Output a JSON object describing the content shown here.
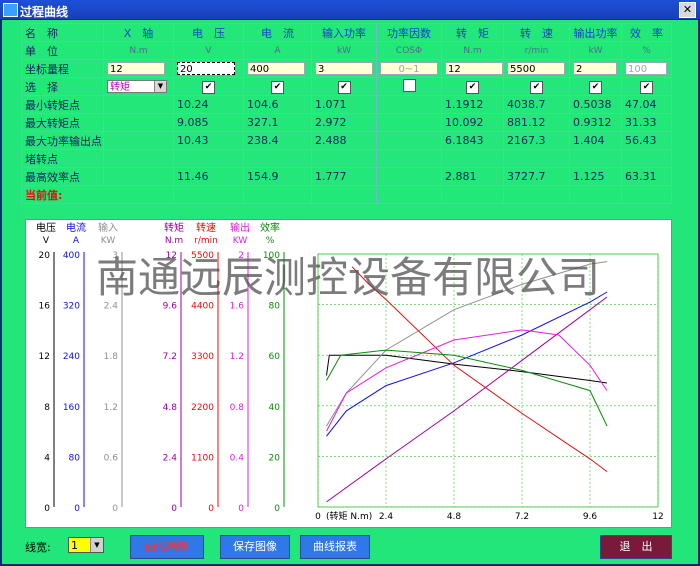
{
  "window": {
    "title": "过程曲线",
    "close_glyph": "✕"
  },
  "table": {
    "headers": [
      "名　称",
      "X　轴",
      "电　压",
      "电　流",
      "输入功率",
      "功率因数",
      "转　矩",
      "转　速",
      "输出功率",
      "效　率"
    ],
    "units_label": "单　位",
    "units": [
      "N.m",
      "V",
      "A",
      "kW",
      "COSΦ",
      "N.m",
      "r/min",
      "kW",
      "%"
    ],
    "range_label": "坐标量程",
    "ranges": [
      "12",
      "20",
      "400",
      "3",
      "0~1",
      "12",
      "5500",
      "2",
      "100"
    ],
    "select_label": "选　择",
    "select_value": "转矩",
    "rows": [
      {
        "label": "最小转矩点",
        "values": [
          "10.24",
          "104.6",
          "1.071",
          "",
          "1.1912",
          "4038.7",
          "0.5038",
          "47.04"
        ]
      },
      {
        "label": "最大转矩点",
        "values": [
          "9.085",
          "327.1",
          "2.972",
          "",
          "10.092",
          "881.12",
          "0.9312",
          "31.33"
        ]
      },
      {
        "label": "最大功率输出点",
        "values": [
          "10.43",
          "238.4",
          "2.488",
          "",
          "6.1843",
          "2167.3",
          "1.404",
          "56.43"
        ]
      },
      {
        "label": "堵转点",
        "values": [
          "",
          "",
          "",
          "",
          "",
          "",
          "",
          ""
        ]
      },
      {
        "label": "最高效率点",
        "values": [
          "11.46",
          "154.9",
          "1.777",
          "",
          "2.881",
          "3727.7",
          "1.125",
          "63.31"
        ]
      }
    ],
    "current_label": "当前值:"
  },
  "chart": {
    "watermark": "南通远辰测控设备有限公司",
    "axes": [
      {
        "name": "电压",
        "unit": "V",
        "ticks": [
          "20",
          "16",
          "12",
          "8",
          "4",
          "0"
        ],
        "color": "#000000"
      },
      {
        "name": "电流",
        "unit": "A",
        "ticks": [
          "400",
          "320",
          "240",
          "160",
          "80",
          "0"
        ],
        "color": "#1010e0"
      },
      {
        "name": "输入",
        "unit": "KW",
        "ticks": [
          "3",
          "2.4",
          "1.8",
          "1.2",
          "0.6",
          "0"
        ],
        "color": "#909090"
      },
      {
        "name": "转矩",
        "unit": "N.m",
        "ticks": [
          "12",
          "9.6",
          "7.2",
          "4.8",
          "2.4",
          "0"
        ],
        "color": "#a000a0"
      },
      {
        "name": "转速",
        "unit": "r/min",
        "ticks": [
          "5500",
          "4400",
          "3300",
          "2200",
          "1100",
          "0"
        ],
        "color": "#e01010"
      },
      {
        "name": "输出",
        "unit": "KW",
        "ticks": [
          "2",
          "1.6",
          "1.2",
          "0.8",
          "0.4",
          "0"
        ],
        "color": "#e020e0"
      },
      {
        "name": "效率",
        "unit": "%",
        "ticks": [
          "100",
          "80",
          "60",
          "40",
          "20",
          "0"
        ],
        "color": "#0a8a0a"
      }
    ],
    "x_ticks": [
      "0",
      "2.4",
      "4.8",
      "7.2",
      "9.6",
      "12"
    ],
    "x_label": "(转矩 N.m)"
  },
  "chart_data": {
    "type": "line",
    "xlabel": "(转矩 N.m)",
    "xlim": [
      0,
      12
    ],
    "ylim": [
      0,
      100
    ],
    "series": [
      {
        "name": "电压",
        "color": "#000000",
        "x": [
          0.3,
          0.4,
          2.4,
          4.8,
          7.2,
          9.6,
          10.2
        ],
        "y": [
          52,
          60,
          60,
          56.5,
          53.5,
          50,
          49
        ]
      },
      {
        "name": "电流",
        "color": "#1010e0",
        "x": [
          0.3,
          1.0,
          2.4,
          4.8,
          7.2,
          9.6,
          10.2
        ],
        "y": [
          28,
          38,
          48,
          57,
          68,
          81,
          85
        ]
      },
      {
        "name": "输入",
        "color": "#909090",
        "x": [
          0.3,
          1.0,
          2.4,
          4.8,
          7.2,
          9.6,
          10.2
        ],
        "y": [
          32,
          45,
          62,
          78,
          88,
          96,
          97
        ]
      },
      {
        "name": "转矩",
        "color": "#a000a0",
        "x": [
          0.3,
          2.4,
          4.8,
          7.2,
          9.6,
          10.2
        ],
        "y": [
          2,
          19,
          38,
          58,
          78,
          83
        ]
      },
      {
        "name": "转速",
        "color": "#e01010",
        "x": [
          1.2,
          1.8,
          2.4,
          4.8,
          7.2,
          9.6,
          10.2
        ],
        "y": [
          95,
          88,
          82,
          56,
          37,
          19,
          14
        ]
      },
      {
        "name": "输出",
        "color": "#e020e0",
        "x": [
          0.3,
          1.0,
          2.4,
          4.8,
          7.2,
          8.5,
          9.6,
          10.2
        ],
        "y": [
          30,
          45,
          55,
          66,
          70,
          68,
          56,
          46
        ]
      },
      {
        "name": "效率",
        "color": "#0a8a0a",
        "x": [
          0.3,
          0.8,
          2.4,
          4.8,
          7.2,
          9.6,
          10.2
        ],
        "y": [
          50,
          60,
          62,
          60,
          54,
          46,
          32
        ]
      }
    ]
  },
  "bottom": {
    "line_width_label": "线宽:",
    "line_width_value": "1",
    "refresh_label": "曲线刷新",
    "save_label": "保存图像",
    "report_label": "曲线报表",
    "exit_label": "退　出"
  }
}
